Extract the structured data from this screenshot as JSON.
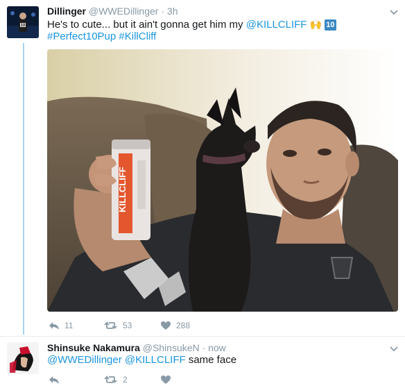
{
  "tweet1": {
    "display_name": "Dillinger",
    "handle": "@WWEDillinger",
    "separator": "·",
    "time": "3h",
    "text_before_mention": "He's to cute... but it ain't gonna get him my ",
    "mention": "@KILLCLIFF",
    "emoji_hands": "🙌",
    "emoji_ten": "10",
    "hashtag1": "#Perfect10Pup",
    "hashtag2": "#KillCliff",
    "reply_count": "11",
    "retweet_count": "53",
    "like_count": "288"
  },
  "tweet2": {
    "display_name": "Shinsuke Nakamura",
    "handle": "@ShinsukeN",
    "separator": "·",
    "time": "now",
    "mention1": "@WWEDillinger",
    "mention2": "@KILLCLIFF",
    "text_after": " same face",
    "retweet_count": "2"
  },
  "colors": {
    "link": "#1b95e0",
    "muted": "#8899a6",
    "thread_line": "#a6d2f2"
  },
  "icons": [
    "caret-down-icon",
    "reply-icon",
    "retweet-icon",
    "heart-icon"
  ]
}
